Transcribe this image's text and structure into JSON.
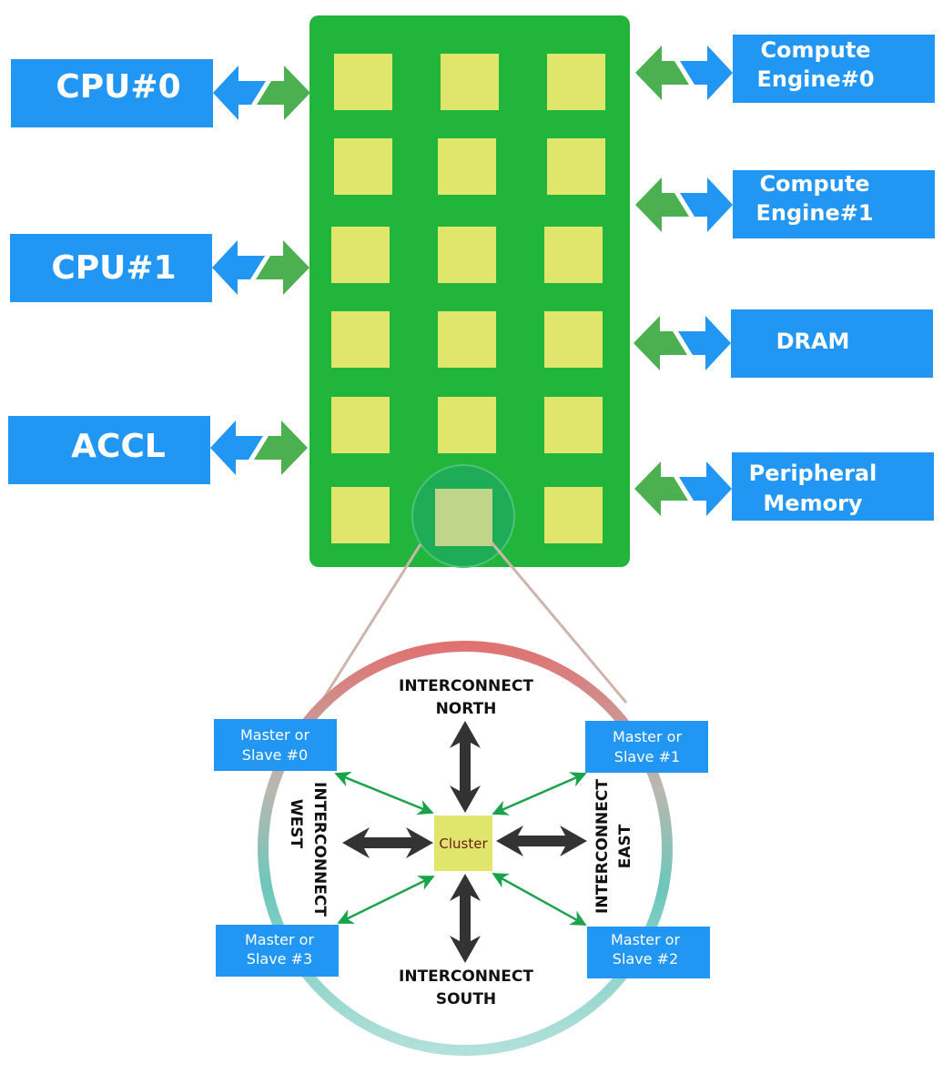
{
  "colors": {
    "blue": "#2196f3",
    "green_board": "#21b63b",
    "arrow_green": "#4caf50",
    "tile": "#e0e66c",
    "tile_highlight": "#bfd68a",
    "cluster_text": "#6b1a1a",
    "ring_top": "#e07272",
    "ring_bottom": "#b2e0da"
  },
  "left_blocks": [
    {
      "label": "CPU#0"
    },
    {
      "label": "CPU#1"
    },
    {
      "label": "ACCL"
    }
  ],
  "right_blocks": [
    {
      "line1": "Compute",
      "line2": "Engine#0"
    },
    {
      "line1": "Compute",
      "line2": "Engine#1"
    },
    {
      "line1": "DRAM",
      "line2": ""
    },
    {
      "line1": "Peripheral",
      "line2": "Memory"
    }
  ],
  "detail": {
    "cluster": "Cluster",
    "north": [
      "INTERCONNECT",
      "NORTH"
    ],
    "south": [
      "INTERCONNECT",
      "SOUTH"
    ],
    "west": [
      "INTERCONNECT",
      "WEST"
    ],
    "east": [
      "INTERCONNECT",
      "EAST"
    ],
    "masters": [
      {
        "line1": "Master or",
        "line2": "Slave #0"
      },
      {
        "line1": "Master or",
        "line2": "Slave #1"
      },
      {
        "line1": "Master or",
        "line2": "Slave #2"
      },
      {
        "line1": "Master or",
        "line2": "Slave #3"
      }
    ]
  }
}
